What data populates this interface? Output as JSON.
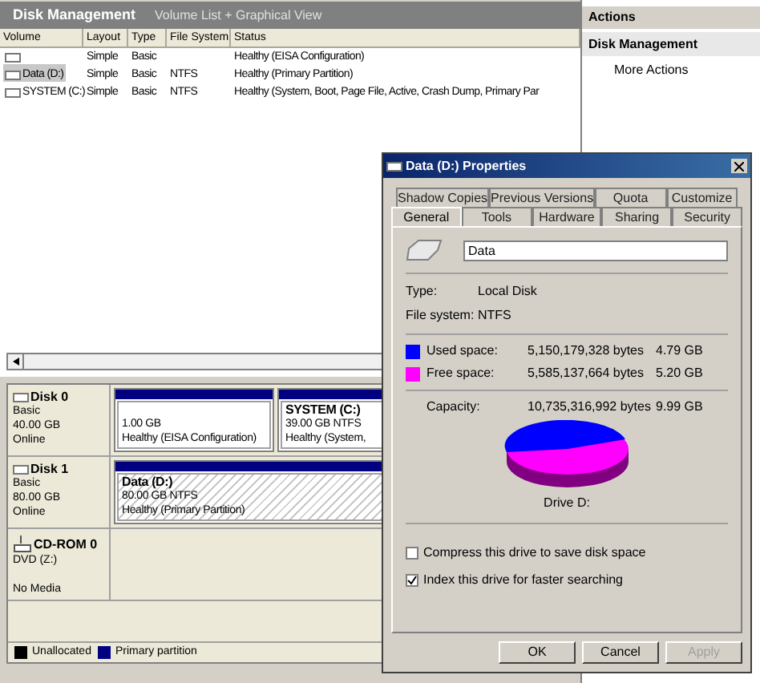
{
  "console": {
    "title": "Disk Management",
    "view": "Volume List + Graphical View"
  },
  "volume_table": {
    "columns": [
      "Volume",
      "Layout",
      "Type",
      "File System",
      "Status"
    ],
    "rows": [
      {
        "cells": [
          "",
          "Simple",
          "Basic",
          "",
          "Healthy (EISA Configuration)"
        ],
        "selected": false
      },
      {
        "cells": [
          "Data (D:)",
          "Simple",
          "Basic",
          "NTFS",
          "Healthy (Primary Partition)"
        ],
        "selected": true
      },
      {
        "cells": [
          "SYSTEM (C:)",
          "Simple",
          "Basic",
          "NTFS",
          "Healthy (System, Boot, Page File, Active, Crash Dump, Primary Par"
        ],
        "selected": false
      }
    ]
  },
  "disks": [
    {
      "kind": "disk",
      "name": "Disk 0",
      "lines": [
        "Basic",
        "40.00 GB",
        "Online"
      ],
      "partitions": [
        {
          "size": "1.00 GB",
          "status": "Healthy (EISA Configuration)",
          "selected": false
        },
        {
          "name": "SYSTEM  (C:)",
          "size": "39.00 GB NTFS",
          "status": "Healthy (System,",
          "selected": false
        }
      ]
    },
    {
      "kind": "disk",
      "name": "Disk 1",
      "lines": [
        "Basic",
        "80.00 GB",
        "Online"
      ],
      "partitions": [
        {
          "name": "Data  (D:)",
          "size": "80.00 GB NTFS",
          "status": "Healthy (Primary Partition)",
          "selected": true
        }
      ]
    },
    {
      "kind": "cdrom",
      "name": "CD-ROM 0",
      "lines": [
        "DVD (Z:)",
        "No Media"
      ]
    }
  ],
  "legend": [
    {
      "label": "Unallocated",
      "color": "#000000"
    },
    {
      "label": "Primary partition",
      "color": "#000080"
    }
  ],
  "actions": {
    "title": "Actions",
    "section": "Disk Management",
    "items": [
      "More Actions"
    ]
  },
  "dialog": {
    "title": "Data (D:) Properties",
    "tab_rows": [
      [
        {
          "label": "Shadow Copies",
          "selected": false
        },
        {
          "label": "Previous Versions",
          "selected": false
        },
        {
          "label": "Quota",
          "selected": false
        },
        {
          "label": "Customize",
          "selected": false
        }
      ],
      [
        {
          "label": "General",
          "selected": true
        },
        {
          "label": "Tools",
          "selected": false
        },
        {
          "label": "Hardware",
          "selected": false
        },
        {
          "label": "Sharing",
          "selected": false
        },
        {
          "label": "Security",
          "selected": false
        }
      ]
    ],
    "label_value": "Data",
    "info": [
      {
        "label": "Type:",
        "value": "Local Disk"
      },
      {
        "label": "File system:",
        "value": "NTFS"
      }
    ],
    "space": [
      {
        "label": "Used space:",
        "bytes": "5,150,179,328 bytes",
        "size": "4.79 GB",
        "color": "#0000ff"
      },
      {
        "label": "Free space:",
        "bytes": "5,585,137,664 bytes",
        "size": "5.20 GB",
        "color": "#ff00ff"
      }
    ],
    "capacity": {
      "label": "Capacity:",
      "bytes": "10,735,316,992 bytes",
      "size": "9.99 GB"
    },
    "drive_label": "Drive D:",
    "options": [
      {
        "label": "Compress this drive to save disk space",
        "checked": false
      },
      {
        "label": "Index this drive for faster searching",
        "checked": true
      }
    ],
    "buttons": [
      {
        "label": "OK",
        "disabled": false
      },
      {
        "label": "Cancel",
        "disabled": false
      },
      {
        "label": "Apply",
        "disabled": true
      }
    ]
  }
}
